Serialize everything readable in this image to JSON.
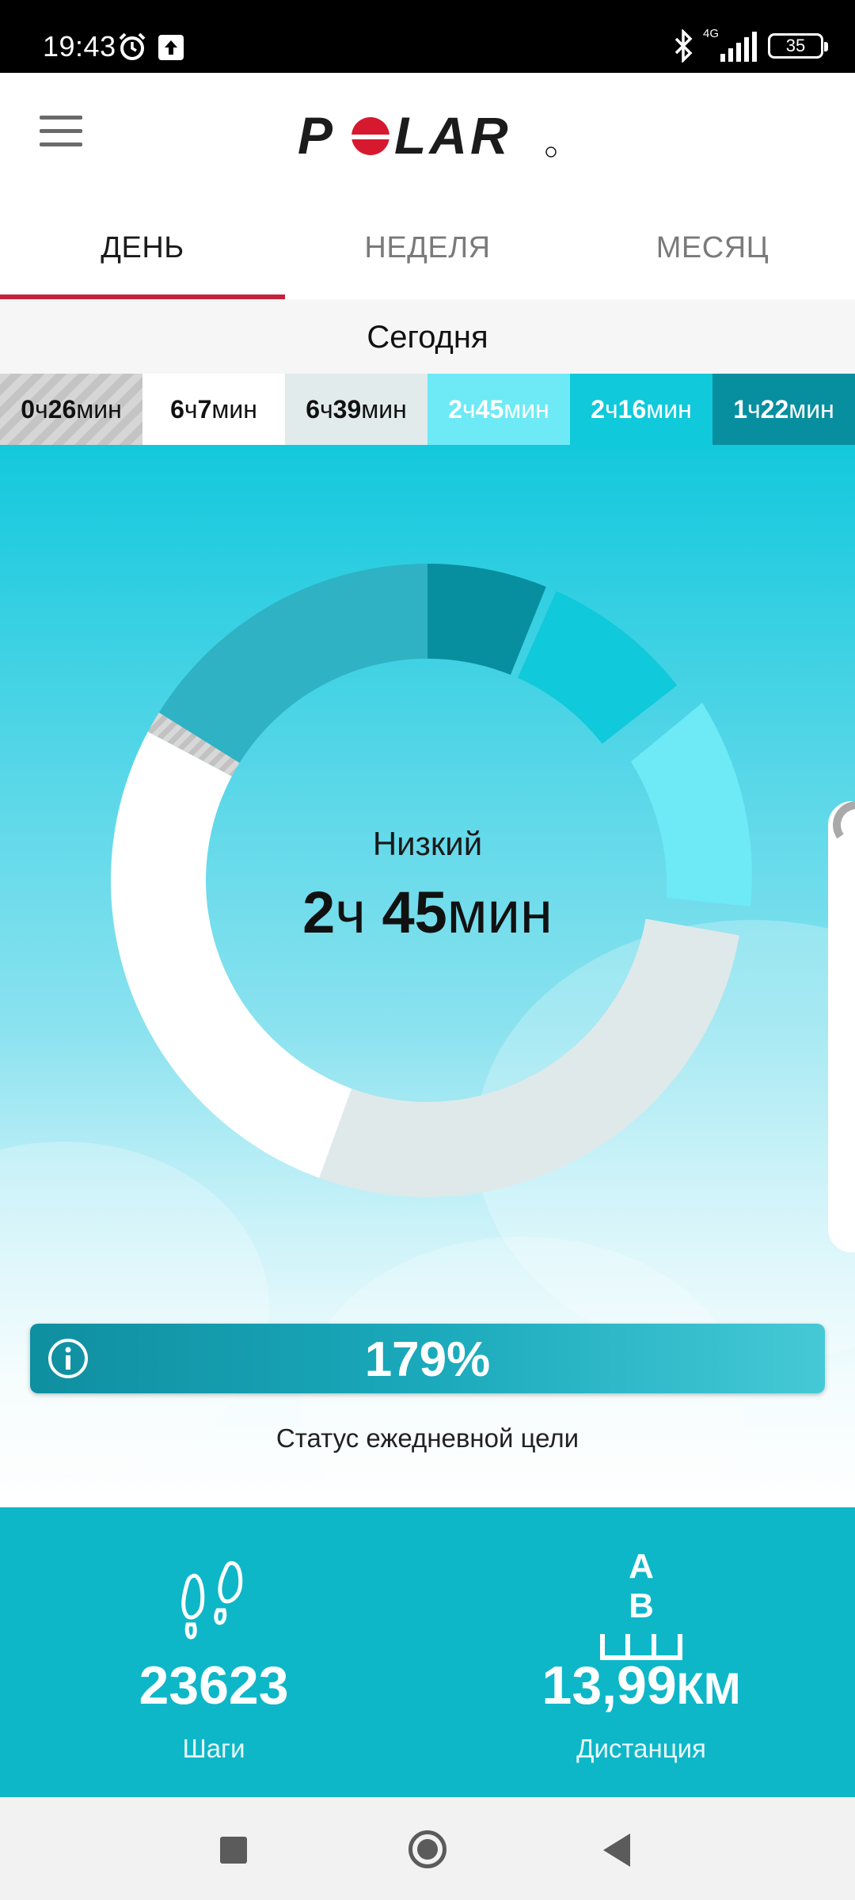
{
  "status_bar": {
    "time": "19:43",
    "network": "4G",
    "battery": "35",
    "icons": [
      "alarm-icon",
      "upload-icon",
      "bluetooth-icon",
      "signal-icon",
      "battery-icon"
    ]
  },
  "header": {
    "brand": "POLAR",
    "menu_icon": "hamburger-icon"
  },
  "tabs": [
    {
      "label": "ДЕНЬ",
      "active": true
    },
    {
      "label": "НЕДЕЛЯ",
      "active": false
    },
    {
      "label": "МЕСЯЦ",
      "active": false
    }
  ],
  "date_label": "Сегодня",
  "zones": [
    {
      "h": "0",
      "hu": "ч",
      "m": "26",
      "mu": "мин",
      "color": "#c4c4c4"
    },
    {
      "h": "6",
      "hu": "ч",
      "m": "7",
      "mu": "мин",
      "color": "#ffffff"
    },
    {
      "h": "6",
      "hu": "ч",
      "m": "39",
      "mu": "мин",
      "color": "#e1ebec"
    },
    {
      "h": "2",
      "hu": "ч",
      "m": "45",
      "mu": "мин",
      "color": "#6ee9f6"
    },
    {
      "h": "2",
      "hu": "ч",
      "m": "16",
      "mu": "мин",
      "color": "#10c9da"
    },
    {
      "h": "1",
      "hu": "ч",
      "m": "22",
      "mu": "мин",
      "color": "#078fa0"
    }
  ],
  "center": {
    "label": "Низкий",
    "h": "2",
    "hu": "ч",
    "m": "45",
    "mu": "мин"
  },
  "goal": {
    "value": "179%",
    "caption": "Статус ежедневной цели",
    "info_icon": "info-icon"
  },
  "stats": {
    "steps": {
      "value": "23623",
      "label": "Шаги",
      "icon": "footsteps-icon"
    },
    "distance": {
      "value": "13,99",
      "unit": "КМ",
      "label": "Дистанция",
      "icon_text": "A B",
      "icon": "distance-icon"
    }
  },
  "colors": {
    "accent": "#c4213a",
    "teal": "#0db7c8"
  }
}
